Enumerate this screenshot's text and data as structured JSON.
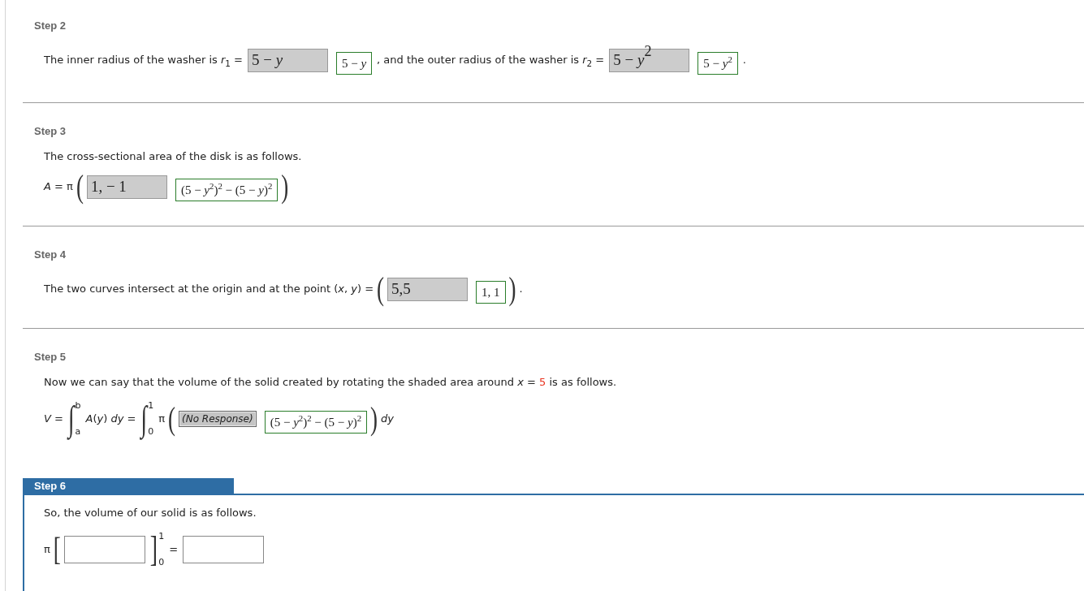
{
  "steps": [
    {
      "title": "Step 2",
      "selected": false,
      "lines": [
        [
          {
            "kind": "text",
            "text": "The inner radius of the washer is *r*$_{1}$ ="
          },
          {
            "kind": "response",
            "value": "5 − *y*"
          },
          {
            "kind": "answer",
            "value": "5 − *y*"
          },
          {
            "kind": "text",
            "text": ", and the outer radius of the washer is *r*$_{2}$ ="
          },
          {
            "kind": "response",
            "value": "5 − *y*$^{2}$"
          },
          {
            "kind": "answer",
            "value": "5 − *y*$^{2}$"
          },
          {
            "kind": "text",
            "text": "."
          }
        ]
      ]
    },
    {
      "title": "Step 3",
      "selected": false,
      "lines": [
        [
          {
            "kind": "text",
            "text": "The cross-sectional area of the disk is as follows."
          }
        ],
        [
          {
            "kind": "math",
            "text": "*A* = π"
          },
          {
            "kind": "delim",
            "text": "("
          },
          {
            "kind": "response",
            "value": "1, − 1"
          },
          {
            "kind": "answer",
            "value": "(5 − *y*$^{2}$)$^{2}$ − (5 − *y*)$^{2}$"
          },
          {
            "kind": "delim",
            "text": ")"
          }
        ]
      ]
    },
    {
      "title": "Step 4",
      "selected": false,
      "lines": [
        [
          {
            "kind": "text",
            "text": "The two curves intersect at the origin and at the point (*x*, *y*) ="
          },
          {
            "kind": "delim",
            "text": "("
          },
          {
            "kind": "response",
            "value": "5,5"
          },
          {
            "kind": "answer",
            "value": "1, 1"
          },
          {
            "kind": "delim",
            "text": ")"
          },
          {
            "kind": "text",
            "text": "."
          }
        ]
      ]
    },
    {
      "title": "Step 5",
      "selected": false,
      "lines": [
        [
          {
            "kind": "text",
            "runs": [
              {
                "text": "Now we can say that the volume of the solid created by rotating the shaded area around *x* = "
              },
              {
                "text": "5",
                "color": "#e8321e"
              },
              {
                "text": " is as follows."
              }
            ]
          }
        ],
        [
          {
            "kind": "math",
            "text": "*V* ="
          },
          {
            "kind": "limits",
            "text": "∫",
            "upper": "b",
            "lower": "a"
          },
          {
            "kind": "math",
            "text": "*A*(*y*) *dy* ="
          },
          {
            "kind": "limits",
            "text": "∫",
            "upper": "1",
            "lower": "0"
          },
          {
            "kind": "math",
            "text": "π"
          },
          {
            "kind": "delim",
            "text": "("
          },
          {
            "kind": "no_response",
            "value": "(No Response)"
          },
          {
            "kind": "answer",
            "value": "(5 − *y*$^{2}$)$^{2}$ − (5 − *y*)$^{2}$"
          },
          {
            "kind": "delim",
            "text": ")"
          },
          {
            "kind": "math",
            "text": "*dy*"
          }
        ]
      ]
    },
    {
      "title": "Step 6",
      "selected": true,
      "lines": [
        [
          {
            "kind": "text",
            "text": "So, the volume of our solid is as follows."
          }
        ],
        [
          {
            "kind": "math",
            "text": "π"
          },
          {
            "kind": "delim",
            "text": "["
          },
          {
            "kind": "input"
          },
          {
            "kind": "limits",
            "text": "]",
            "upper": "1",
            "lower": "0"
          },
          {
            "kind": "math",
            "text": "="
          },
          {
            "kind": "input"
          }
        ]
      ]
    }
  ]
}
